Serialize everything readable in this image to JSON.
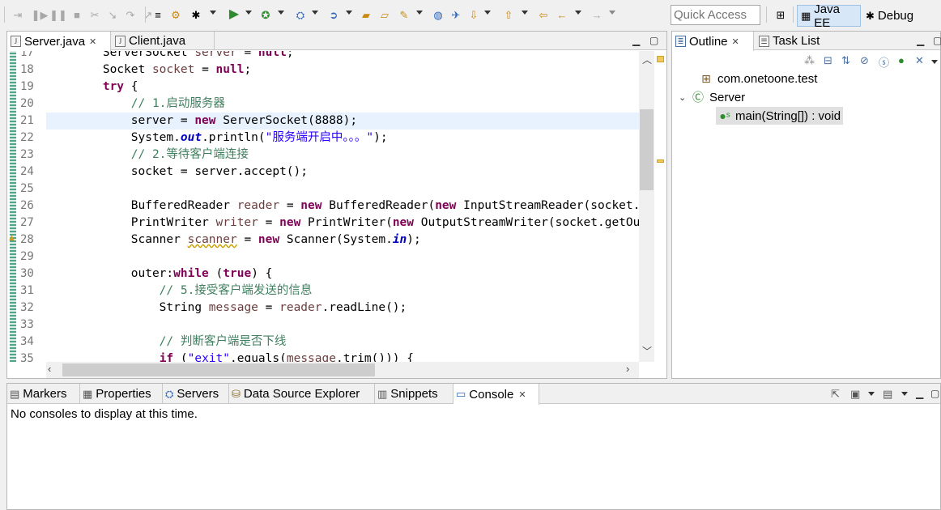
{
  "toolbar": {
    "quick_access_placeholder": "Quick Access",
    "perspectives": [
      {
        "label": "Java EE",
        "icon": "java-ee-perspective-icon",
        "active": true
      },
      {
        "label": "Debug",
        "icon": "bug-icon",
        "active": false
      }
    ]
  },
  "editor": {
    "tabs": [
      {
        "label": "Server.java",
        "active": true
      },
      {
        "label": "Client.java",
        "active": false
      }
    ],
    "line_numbers": [
      "17",
      "18",
      "19",
      "20",
      "21",
      "22",
      "23",
      "24",
      "25",
      "26",
      "27",
      "28",
      "29",
      "30",
      "31",
      "32",
      "33",
      "34",
      "35"
    ],
    "code_lines": [
      [
        {
          "t": "        ServerSocket ",
          "c": ""
        },
        {
          "t": "server",
          "c": "var"
        },
        {
          "t": " = ",
          "c": ""
        },
        {
          "t": "null",
          "c": "kw"
        },
        {
          "t": ";",
          "c": ""
        }
      ],
      [
        {
          "t": "        Socket ",
          "c": ""
        },
        {
          "t": "socket",
          "c": "var"
        },
        {
          "t": " = ",
          "c": ""
        },
        {
          "t": "null",
          "c": "kw"
        },
        {
          "t": ";",
          "c": ""
        }
      ],
      [
        {
          "t": "        ",
          "c": ""
        },
        {
          "t": "try",
          "c": "kw"
        },
        {
          "t": " {",
          "c": ""
        }
      ],
      [
        {
          "t": "            // 1.启动服务器",
          "c": "cm"
        }
      ],
      [
        {
          "t": "            server = ",
          "c": ""
        },
        {
          "t": "new",
          "c": "kw"
        },
        {
          "t": " ServerSocket(8888);",
          "c": ""
        }
      ],
      [
        {
          "t": "            System.",
          "c": ""
        },
        {
          "t": "out",
          "c": "fld"
        },
        {
          "t": ".println(",
          "c": ""
        },
        {
          "t": "\"服务端开启中。。。\"",
          "c": "str"
        },
        {
          "t": ");",
          "c": ""
        }
      ],
      [
        {
          "t": "            // 2.等待客户端连接",
          "c": "cm"
        }
      ],
      [
        {
          "t": "            socket = server.accept();",
          "c": ""
        }
      ],
      [
        {
          "t": "",
          "c": ""
        }
      ],
      [
        {
          "t": "            BufferedReader ",
          "c": ""
        },
        {
          "t": "reader",
          "c": "var"
        },
        {
          "t": " = ",
          "c": ""
        },
        {
          "t": "new",
          "c": "kw"
        },
        {
          "t": " BufferedReader(",
          "c": ""
        },
        {
          "t": "new",
          "c": "kw"
        },
        {
          "t": " InputStreamReader(socket.getInputStream()));",
          "c": ""
        }
      ],
      [
        {
          "t": "            PrintWriter ",
          "c": ""
        },
        {
          "t": "writer",
          "c": "var"
        },
        {
          "t": " = ",
          "c": ""
        },
        {
          "t": "new",
          "c": "kw"
        },
        {
          "t": " PrintWriter(",
          "c": ""
        },
        {
          "t": "new",
          "c": "kw"
        },
        {
          "t": " OutputStreamWriter(socket.getOutputStream()));",
          "c": ""
        }
      ],
      [
        {
          "t": "            Scanner ",
          "c": ""
        },
        {
          "t": "scanner",
          "c": "var wv"
        },
        {
          "t": " = ",
          "c": ""
        },
        {
          "t": "new",
          "c": "kw"
        },
        {
          "t": " Scanner(System.",
          "c": ""
        },
        {
          "t": "in",
          "c": "fld"
        },
        {
          "t": ");",
          "c": ""
        }
      ],
      [
        {
          "t": "",
          "c": ""
        }
      ],
      [
        {
          "t": "            outer:",
          "c": ""
        },
        {
          "t": "while",
          "c": "kw"
        },
        {
          "t": " (",
          "c": ""
        },
        {
          "t": "true",
          "c": "kw"
        },
        {
          "t": ") {",
          "c": ""
        }
      ],
      [
        {
          "t": "                // 5.接受客户端发送的信息",
          "c": "cm"
        }
      ],
      [
        {
          "t": "                String ",
          "c": ""
        },
        {
          "t": "message",
          "c": "var"
        },
        {
          "t": " = ",
          "c": ""
        },
        {
          "t": "reader",
          "c": "var"
        },
        {
          "t": ".readLine();",
          "c": ""
        }
      ],
      [
        {
          "t": "",
          "c": ""
        }
      ],
      [
        {
          "t": "                // 判断客户端是否下线",
          "c": "cm"
        }
      ],
      [
        {
          "t": "                ",
          "c": ""
        },
        {
          "t": "if",
          "c": "kw"
        },
        {
          "t": " (",
          "c": ""
        },
        {
          "t": "\"exit\"",
          "c": "str"
        },
        {
          "t": ".equals(",
          "c": ""
        },
        {
          "t": "message",
          "c": "var"
        },
        {
          "t": ".trim())) {",
          "c": ""
        }
      ]
    ]
  },
  "outline": {
    "tabs": [
      {
        "label": "Outline",
        "active": true
      },
      {
        "label": "Task List",
        "active": false
      }
    ],
    "tree": {
      "package": "com.onetoone.test",
      "class": "Server",
      "method": "main(String[]) : void"
    }
  },
  "console": {
    "tabs": [
      {
        "label": "Markers",
        "icon": "markers-icon"
      },
      {
        "label": "Properties",
        "icon": "properties-icon"
      },
      {
        "label": "Servers",
        "icon": "servers-icon"
      },
      {
        "label": "Data Source Explorer",
        "icon": "data-source-icon"
      },
      {
        "label": "Snippets",
        "icon": "snippets-icon"
      },
      {
        "label": "Console",
        "icon": "console-icon"
      }
    ],
    "message": "No consoles to display at this time."
  }
}
